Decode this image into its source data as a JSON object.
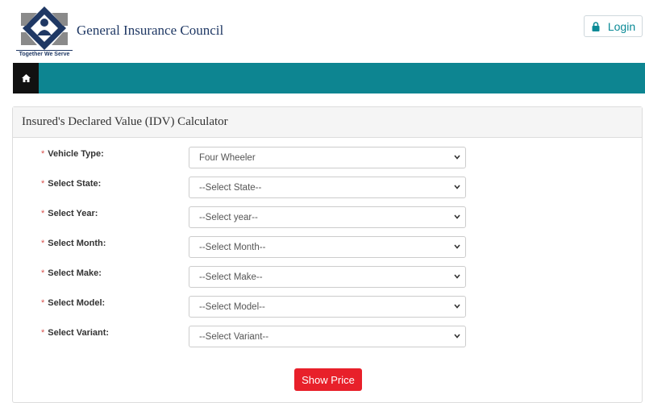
{
  "header": {
    "org_name": "General Insurance Council",
    "tagline": "Together We Serve",
    "login_label": "Login"
  },
  "navbar": {
    "home_icon": "home-icon"
  },
  "calculator": {
    "title": "Insured's Declared Value (IDV) Calculator",
    "required_marker": "*",
    "fields": [
      {
        "label": "Vehicle Type:",
        "value": "Four Wheeler"
      },
      {
        "label": "Select State:",
        "value": "--Select State--"
      },
      {
        "label": "Select Year:",
        "value": "--Select year--"
      },
      {
        "label": "Select Month:",
        "value": "--Select Month--"
      },
      {
        "label": "Select Make:",
        "value": "--Select Make--"
      },
      {
        "label": "Select Model:",
        "value": "--Select Model--"
      },
      {
        "label": "Select Variant:",
        "value": "--Select Variant--"
      }
    ],
    "submit_label": "Show Price"
  },
  "colors": {
    "navbar": "#0d8591",
    "brand_text": "#1f3864",
    "login_text": "#0a8a96",
    "required": "#d9534f",
    "submit": "#e8202a"
  }
}
